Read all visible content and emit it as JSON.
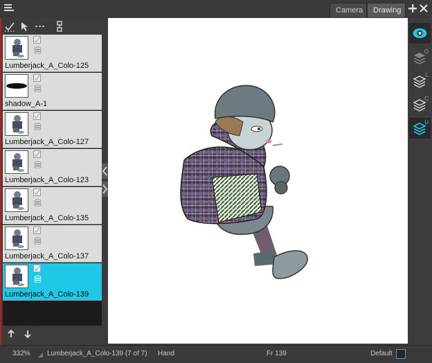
{
  "tabs": [
    {
      "label": "Camera",
      "active": false
    },
    {
      "label": "Drawing",
      "active": true
    }
  ],
  "toolbar": {
    "icons": [
      "select-check-icon",
      "select-arrow-icon",
      "dotted-line-icon",
      "link-icon"
    ]
  },
  "layers": [
    {
      "name": "Lumberjack_A_Colo-125",
      "selected": false,
      "thumb": "character"
    },
    {
      "name": "shadow_A-1",
      "selected": false,
      "thumb": "shadow"
    },
    {
      "name": "Lumberjack_A_Colo-127",
      "selected": false,
      "thumb": "character"
    },
    {
      "name": "Lumberjack_A_Colo-123",
      "selected": false,
      "thumb": "character"
    },
    {
      "name": "Lumberjack_A_Colo-135",
      "selected": false,
      "thumb": "character"
    },
    {
      "name": "Lumberjack_A_Colo-137",
      "selected": false,
      "thumb": "character"
    },
    {
      "name": "Lumberjack_A_Colo-139",
      "selected": true,
      "thumb": "character"
    }
  ],
  "right_toolbar": [
    {
      "icon": "eye-icon",
      "letter": "",
      "active": true
    },
    {
      "icon": "layers-overlay-icon",
      "letter": "O",
      "active": false
    },
    {
      "icon": "layers-line-icon",
      "letter": "L",
      "active": false
    },
    {
      "icon": "layers-color-icon",
      "letter": "C",
      "active": false
    },
    {
      "icon": "layers-underlay-icon",
      "letter": "U",
      "active": true
    }
  ],
  "status": {
    "zoom": "332%",
    "drawing": "Lumberjack_A_Colo-139 (7 of 7)",
    "tool": "Hand",
    "frame": "Fr 139",
    "palette": "Default"
  },
  "colors": {
    "selected_layer": "#1fc8e6",
    "accent_red": "#b22222",
    "swatch": "#1e2a3a"
  }
}
